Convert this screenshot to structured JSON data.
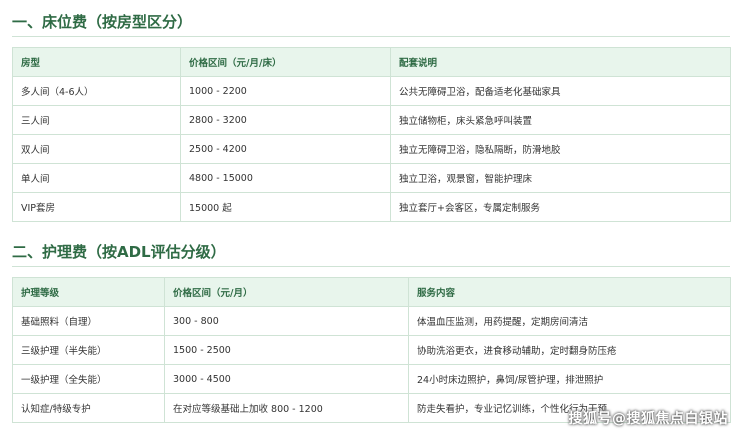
{
  "section1": {
    "title": "一、床位费（按房型区分）",
    "headers": [
      "房型",
      "价格区间（元/月/床）",
      "配套说明"
    ],
    "rows": [
      [
        "多人间（4-6人）",
        "1000 - 2200",
        "公共无障碍卫浴，配备适老化基础家具"
      ],
      [
        "三人间",
        "2800 - 3200",
        "独立储物柜，床头紧急呼叫装置"
      ],
      [
        "双人间",
        "2500 - 4200",
        "独立无障碍卫浴，隐私隔断，防滑地胶"
      ],
      [
        "单人间",
        "4800 - 15000",
        "独立卫浴，观景窗，智能护理床"
      ],
      [
        "VIP套房",
        "15000 起",
        "独立套厅+会客区，专属定制服务"
      ]
    ]
  },
  "section2": {
    "title": "二、护理费（按ADL评估分级）",
    "headers": [
      "护理等级",
      "价格区间（元/月）",
      "服务内容"
    ],
    "rows": [
      [
        "基础照料（自理）",
        "300 - 800",
        "体温血压监测，用药提醒，定期房间清洁"
      ],
      [
        "三级护理（半失能）",
        "1500 - 2500",
        "协助洗浴更衣，进食移动辅助，定时翻身防压疮"
      ],
      [
        "一级护理（全失能）",
        "3000 - 4500",
        "24小时床边照护，鼻饲/尿管护理，排泄照护"
      ],
      [
        "认知症/特级专护",
        "在对应等级基础上加收 800 - 1200",
        "防走失看护，专业记忆训练，个性化行为干预"
      ]
    ]
  },
  "watermark": "搜狐号@搜狐焦点白银站"
}
